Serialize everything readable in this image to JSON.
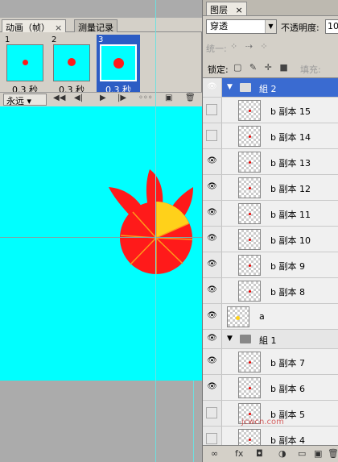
{
  "animation_panel": {
    "tabs": [
      {
        "label": "动画（帧）",
        "close": "×"
      },
      {
        "label": "测量记录"
      }
    ],
    "frames": [
      {
        "number": "1",
        "delay": "0.3 秒"
      },
      {
        "number": "2",
        "delay": "0.3 秒"
      },
      {
        "number": "3",
        "delay": "0.3 秒"
      }
    ],
    "loop_option": "永远",
    "controls": [
      "first-frame-icon",
      "prev-frame-icon",
      "play-icon",
      "next-frame-icon",
      "tween-icon",
      "duplicate-frame-icon",
      "delete-frame-icon"
    ]
  },
  "layers_panel": {
    "tab_label": "图层",
    "tab_close": "×",
    "blend_mode": "穿透",
    "opacity_label": "不透明度:",
    "opacity_value": "10",
    "unify_label": "统一:",
    "lock_label": "锁定:",
    "fill_label": "填充:",
    "layers": [
      {
        "name": "組 2",
        "type": "group",
        "visible": true,
        "selected": true
      },
      {
        "name": "b 副本 15",
        "type": "layer",
        "visible": false
      },
      {
        "name": "b 副本 14",
        "type": "layer",
        "visible": false
      },
      {
        "name": "b 副本 13",
        "type": "layer",
        "visible": true
      },
      {
        "name": "b 副本 12",
        "type": "layer",
        "visible": true
      },
      {
        "name": "b 副本 11",
        "type": "layer",
        "visible": true
      },
      {
        "name": "b 副本 10",
        "type": "layer",
        "visible": true
      },
      {
        "name": "b 副本 9",
        "type": "layer",
        "visible": true
      },
      {
        "name": "b 副本 8",
        "type": "layer",
        "visible": true
      },
      {
        "name": "a",
        "type": "layer",
        "visible": true
      },
      {
        "name": "組 1",
        "type": "group",
        "visible": true
      },
      {
        "name": "b 副本 7",
        "type": "layer",
        "visible": true
      },
      {
        "name": "b 副本 6",
        "type": "layer",
        "visible": true
      },
      {
        "name": "b 副本 5",
        "type": "layer",
        "visible": false
      },
      {
        "name": "b 副本 4",
        "type": "layer",
        "visible": false
      }
    ],
    "watermark": "jcwcn.com"
  },
  "colors": {
    "canvas": "#00ffff",
    "selection": "#3a6bd1",
    "flower_red": "#ff1a1a",
    "flower_yellow": "#ffd11a"
  }
}
